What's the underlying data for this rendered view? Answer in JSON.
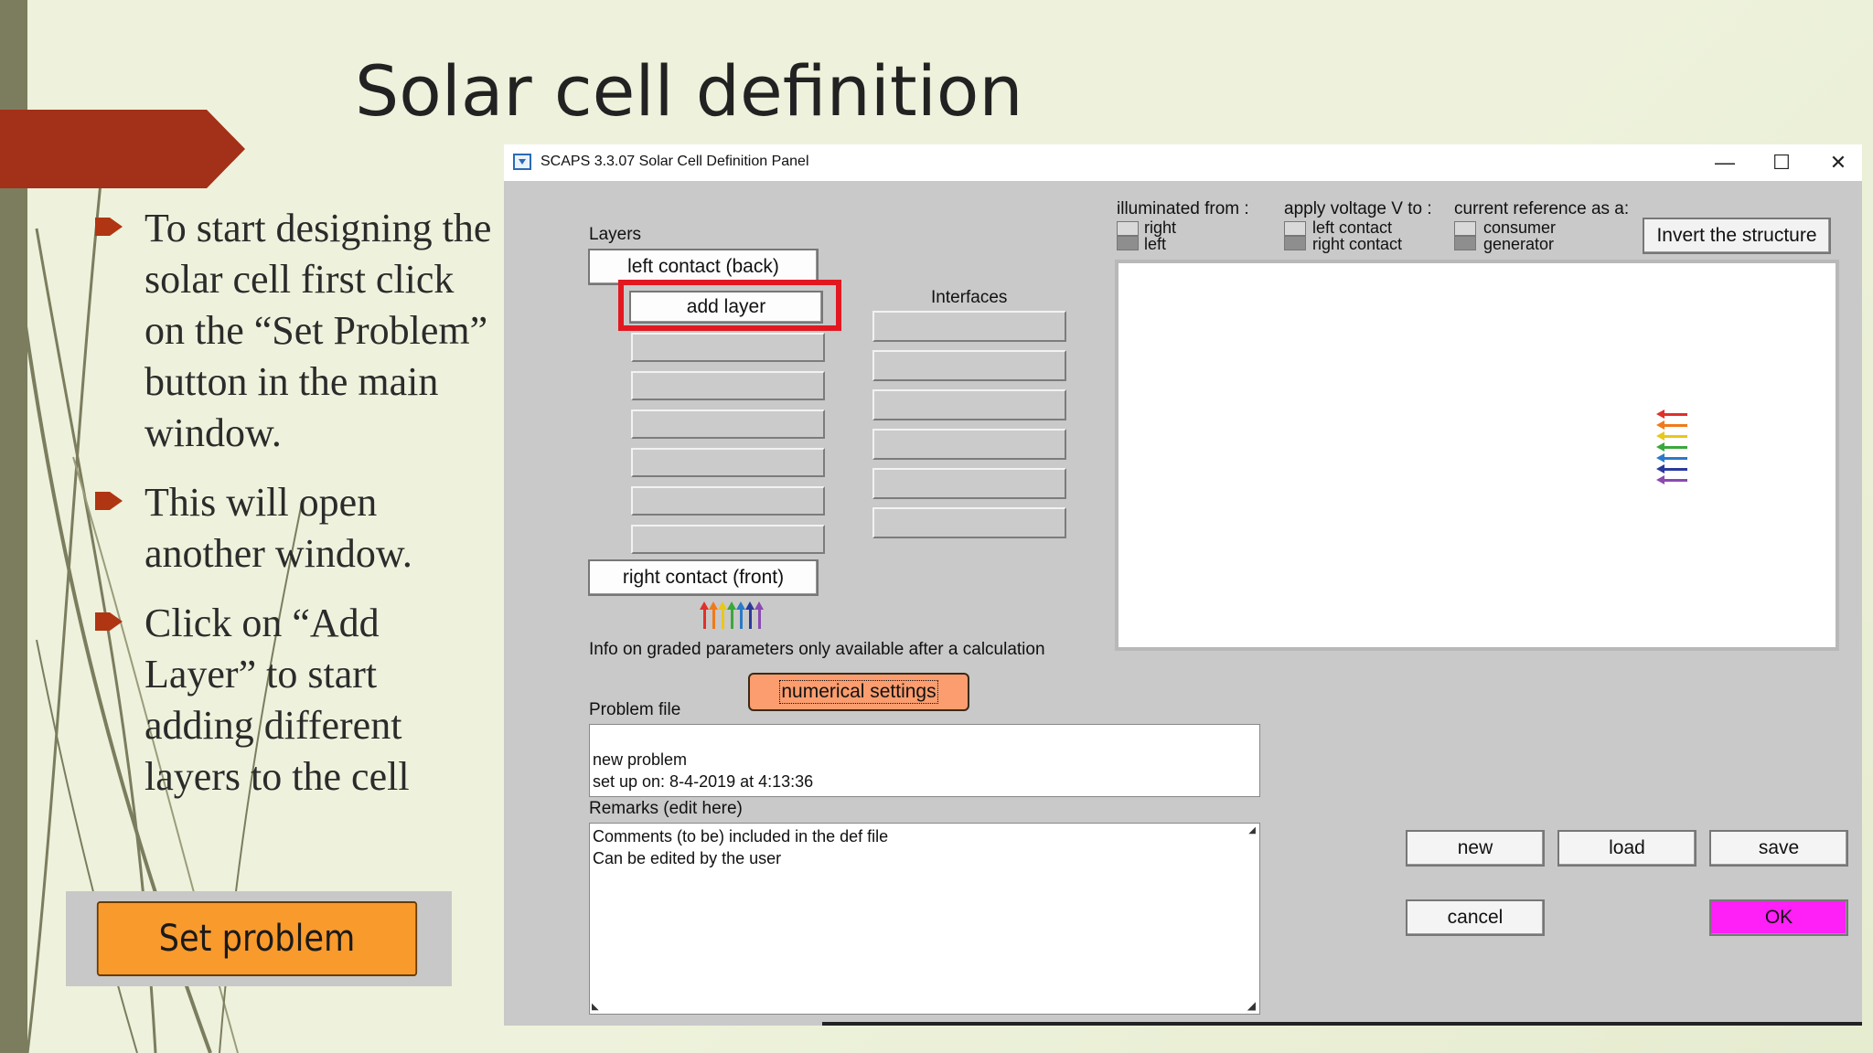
{
  "slide": {
    "title": "Solar cell definition",
    "bullets": [
      "To start designing the solar cell first click on the “Set Problem” button in the main window.",
      "This will open another window.",
      "Click on “Add Layer” to start adding different layers to the cell"
    ],
    "set_problem_label": "Set problem",
    "accent_color": "#b03512",
    "button_color": "#f99a2c"
  },
  "window": {
    "title": "SCAPS 3.3.07 Solar Cell Definition Panel",
    "controls": {
      "minimize": "—",
      "maximize": "☐",
      "close": "✕"
    },
    "layers": {
      "label": "Layers",
      "left_contact": "left contact (back)",
      "add_layer": "add layer",
      "right_contact": "right contact (front)"
    },
    "interfaces_label": "Interfaces",
    "illuminated_from": {
      "label": "illuminated from :",
      "options": [
        "right",
        "left"
      ]
    },
    "apply_voltage": {
      "label": "apply voltage V to :",
      "options": [
        "left contact",
        "right contact"
      ]
    },
    "current_reference": {
      "label": "current reference as a:",
      "options": [
        "consumer",
        "generator"
      ]
    },
    "invert_button": "Invert the structure",
    "graded_info": "Info on graded parameters only available after a calculation",
    "numerical_settings": "numerical settings",
    "problem_file": {
      "label": "Problem file",
      "line1": "new problem",
      "line2": "set up on: 8-4-2019 at 4:13:36"
    },
    "remarks": {
      "label": "Remarks (edit here)",
      "line1": "Comments (to be) included in the def file",
      "line2": "Can be edited by the user"
    },
    "buttons": {
      "new": "new",
      "load": "load",
      "save": "save",
      "cancel": "cancel",
      "ok": "OK"
    },
    "ok_color": "#ff1ff7",
    "spectrum_colors": [
      "#e0302a",
      "#f07a1a",
      "#e8c81a",
      "#3aa83a",
      "#2a7ac8",
      "#2a3a9a",
      "#8a4ab0"
    ]
  }
}
